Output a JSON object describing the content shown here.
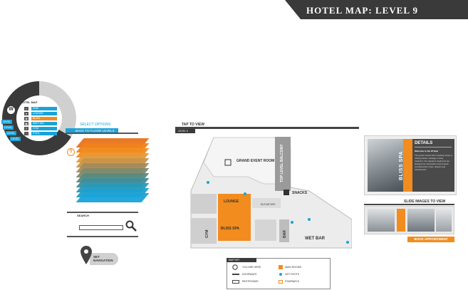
{
  "header": {
    "title": "HOTEL MAP: LEVEL 9",
    "color": "#3a3a3a"
  },
  "colors": {
    "accent": "#1aa3d9",
    "highlight": "#f28c1e",
    "dark": "#3a3a3a"
  },
  "wheel": {
    "logo": "W",
    "title": "HOTEL MAP",
    "items": [
      {
        "icon": "bed-icon",
        "label": "DINE"
      },
      {
        "icon": "glass-icon",
        "label": "LOUNGE"
      },
      {
        "icon": "spa-icon",
        "label": "BLISS"
      },
      {
        "icon": "room-icon",
        "label": "MEETING"
      },
      {
        "icon": "gym-icon",
        "label": "GYM"
      },
      {
        "icon": "pool-icon",
        "label": "POOL"
      }
    ],
    "tags": [
      "LEVEL",
      "LEVEL",
      "LEVEL",
      "LEVEL"
    ]
  },
  "select_options": "SELECT OPTIONS",
  "back_button": "BACK TO FLOOR LEVELS",
  "floor_badge": "9",
  "search": {
    "label": "SEARCH",
    "placeholder": ""
  },
  "navigation": {
    "label": "SET NAVIGATION"
  },
  "map": {
    "tap_label": "TAP TO VIEW",
    "level_tab": "LEVEL 9",
    "rooms": {
      "grand_event": "GRAND EVENT ROOM",
      "balcony": "TOP LEVEL BALCONY",
      "snacks": "SNACKS",
      "lounge": "LOUNGE",
      "elevators": "ELEVATORS",
      "gym": "GYM",
      "bliss_spa": "BLISS SPA",
      "bar": "BAR",
      "wet_bar": "WET BAR"
    }
  },
  "key": {
    "title": "MAP KEY",
    "items": [
      {
        "icon": "you-are-here-icon",
        "label": "YOU ARE HERE"
      },
      {
        "icon": "main-rooms-icon",
        "label": "MAIN ROOMS"
      },
      {
        "icon": "doorways-icon",
        "label": "DOORWAYS"
      },
      {
        "icon": "hot-spots-icon",
        "label": "HOT SPOTS"
      },
      {
        "icon": "restrooms-icon",
        "label": "RESTROOMS"
      },
      {
        "icon": "stairways-icon",
        "label": "STAIRWAYS"
      }
    ]
  },
  "details": {
    "spa_name": "BLISS SPA",
    "title": "DETAILS",
    "subtitle": "Welcome to the W Spa!",
    "body": "The perfect retreat when traveling. Enjoy a relaxing facial, massage or body treatment. Our signature treatments are designed for rejuvenation and renewal. Complimentary robes, slippers and refreshments.",
    "slide_label": "SLIDE IMAGES TO VIEW",
    "book_button": "BOOK APPOINTMENT"
  }
}
